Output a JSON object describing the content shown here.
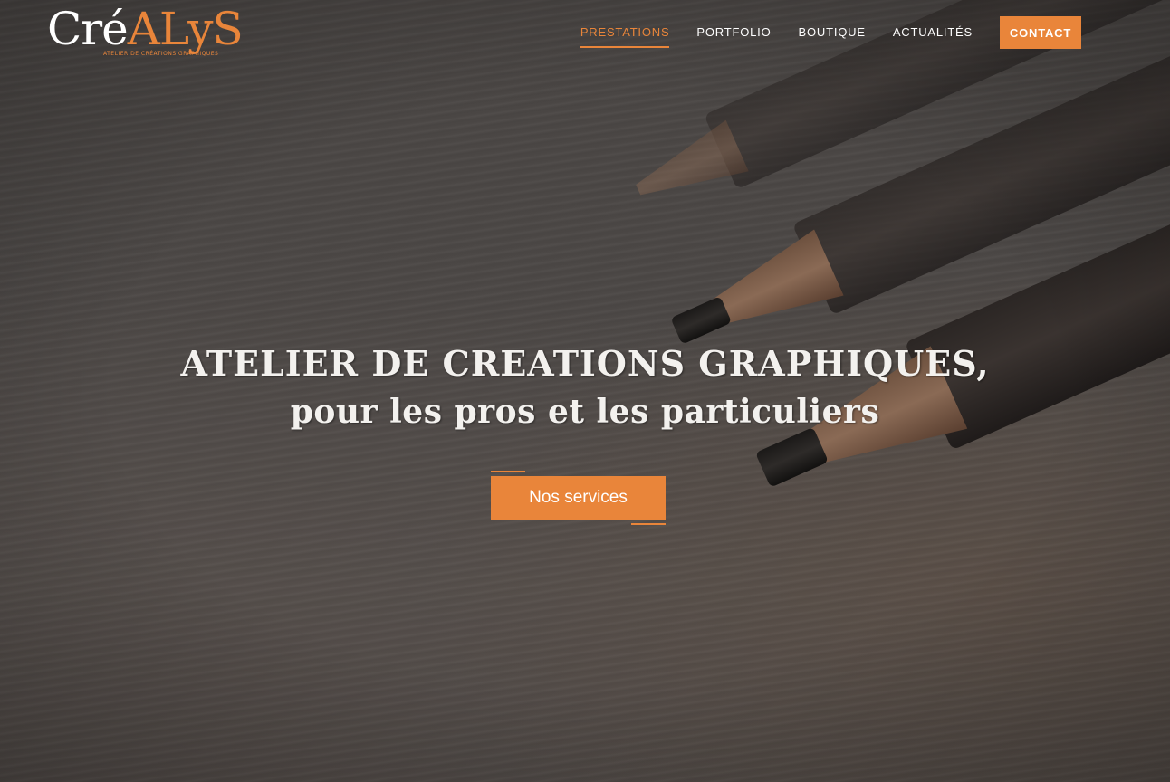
{
  "brand": {
    "logo_parts": [
      "C",
      "ré",
      "A",
      "LyS"
    ],
    "tagline": "ATELIER DE CRÉATIONS GRAPHIQUES"
  },
  "nav": {
    "items": [
      {
        "label": "PRESTATIONS",
        "active": true
      },
      {
        "label": "PORTFOLIO",
        "active": false
      },
      {
        "label": "BOUTIQUE",
        "active": false
      },
      {
        "label": "ACTUALITÉS",
        "active": false
      }
    ],
    "contact_label": "CONTACT"
  },
  "hero": {
    "headline_line1": "ATELIER DE CREATIONS GRAPHIQUES,",
    "headline_line2": "pour les pros et les particuliers",
    "cta_label": "Nos services"
  },
  "colors": {
    "accent": "#e9853a",
    "text_light": "#f3f1ee"
  }
}
